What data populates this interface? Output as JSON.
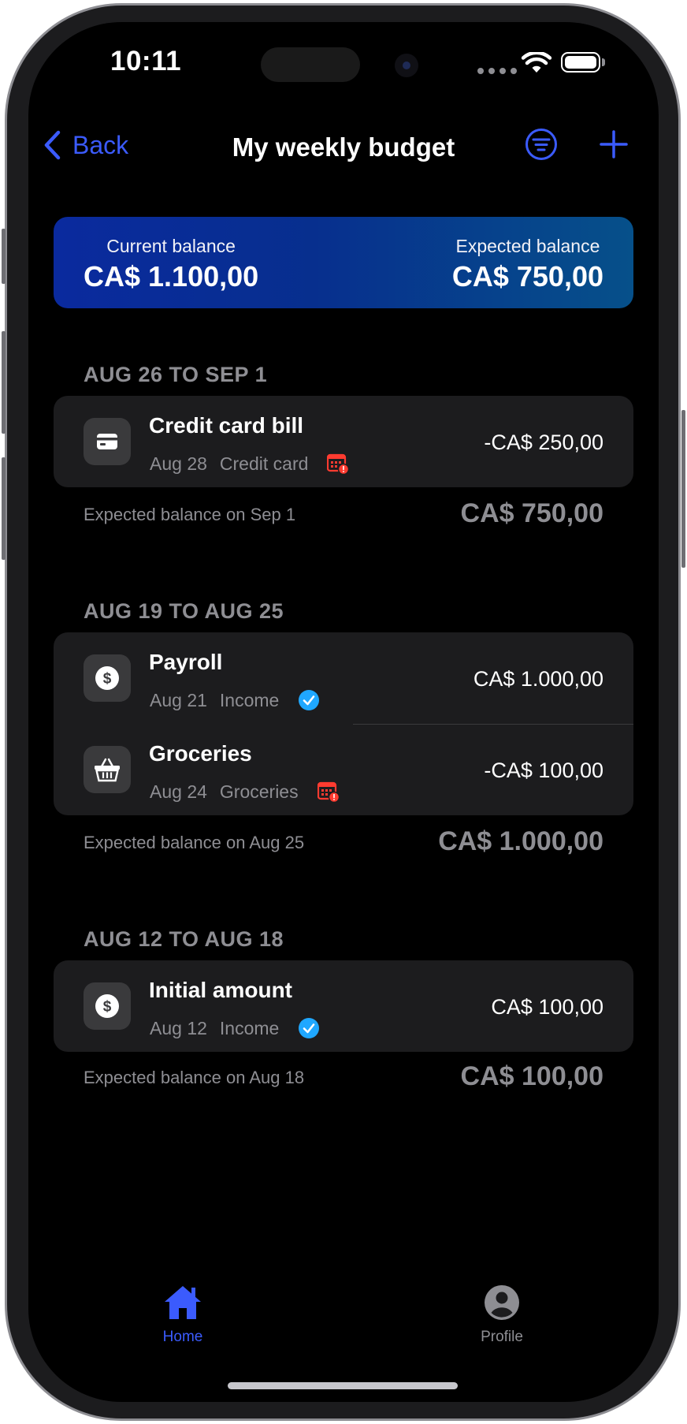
{
  "status_bar": {
    "time": "10:11"
  },
  "nav": {
    "back_label": "Back",
    "title": "My weekly budget"
  },
  "balance": {
    "current_label": "Current balance",
    "current_value": "CA$ 1.100,00",
    "expected_label": "Expected balance",
    "expected_value": "CA$ 750,00"
  },
  "weeks": [
    {
      "title": "AUG 26 TO SEP 1",
      "transactions": [
        {
          "title": "Credit card bill",
          "date": "Aug 28",
          "category": "Credit card",
          "amount": "-CA$ 250,00",
          "icon": "credit-card-icon",
          "status_icon": "calendar-alert-icon"
        }
      ],
      "expected_label": "Expected balance on Sep 1",
      "expected_value": "CA$ 750,00"
    },
    {
      "title": "AUG 19 TO AUG 25",
      "transactions": [
        {
          "title": "Payroll",
          "date": "Aug 21",
          "category": "Income",
          "amount": "CA$ 1.000,00",
          "icon": "dollar-icon",
          "status_icon": "check-badge-icon"
        },
        {
          "title": "Groceries",
          "date": "Aug 24",
          "category": "Groceries",
          "amount": "-CA$ 100,00",
          "icon": "basket-icon",
          "status_icon": "calendar-alert-icon"
        }
      ],
      "expected_label": "Expected balance on Aug 25",
      "expected_value": "CA$ 1.000,00"
    },
    {
      "title": "AUG 12 TO AUG 18",
      "transactions": [
        {
          "title": "Initial amount",
          "date": "Aug 12",
          "category": "Income",
          "amount": "CA$ 100,00",
          "icon": "dollar-icon",
          "status_icon": "check-badge-icon"
        }
      ],
      "expected_label": "Expected balance on Aug 18",
      "expected_value": "CA$ 100,00"
    }
  ],
  "tabs": [
    {
      "label": "Home",
      "icon": "home-icon",
      "active": true
    },
    {
      "label": "Profile",
      "icon": "profile-icon",
      "active": false
    }
  ],
  "colors": {
    "accent": "#3b5bfd",
    "alert": "#ff3b30",
    "check": "#1fa7ff",
    "background": "#000000",
    "card": "#1c1c1e"
  }
}
